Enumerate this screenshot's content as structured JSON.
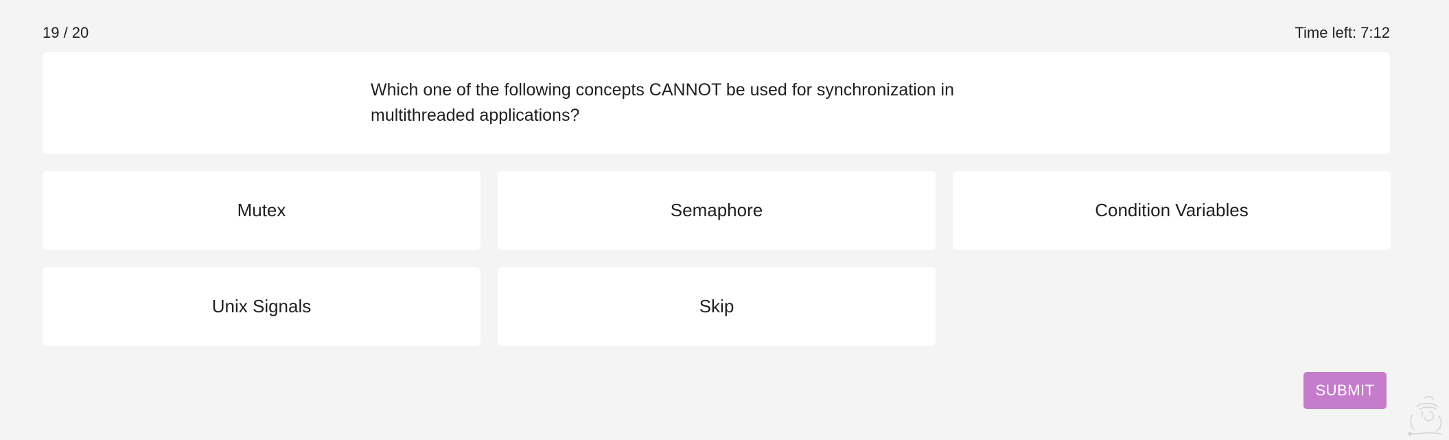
{
  "header": {
    "progress": "19 / 20",
    "timer": "Time left: 7:12"
  },
  "question": {
    "text": "Which one of the following concepts CANNOT be used for synchronization in multithreaded applications?"
  },
  "options": [
    {
      "label": "Mutex"
    },
    {
      "label": "Semaphore"
    },
    {
      "label": "Condition Variables"
    },
    {
      "label": "Unix Signals"
    },
    {
      "label": "Skip"
    }
  ],
  "actions": {
    "submit_label": "SUBMIT"
  },
  "colors": {
    "background": "#f4f4f4",
    "card": "#ffffff",
    "submit": "#c47ccb"
  },
  "icons": {
    "corner": "mascot-icon"
  }
}
